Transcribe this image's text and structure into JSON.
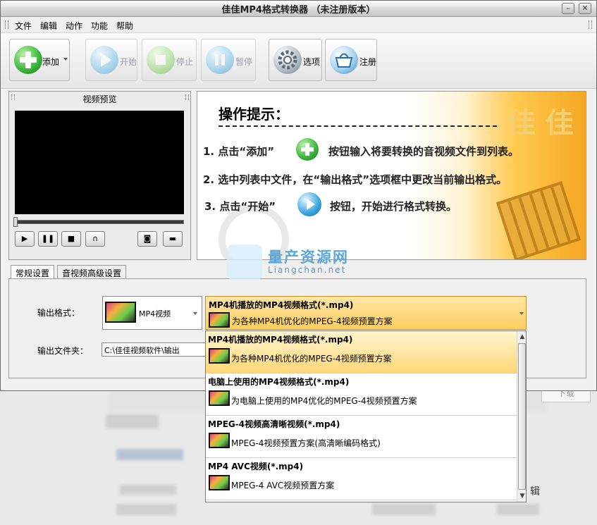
{
  "window": {
    "title": "佳佳MP4格式转换器  （未注册版本）"
  },
  "menu": [
    "文件",
    "编辑",
    "动作",
    "功能",
    "帮助"
  ],
  "toolbar": {
    "add": "添加",
    "start": "开始",
    "stop": "停止",
    "pause": "暂停",
    "options": "选项",
    "register": "注册"
  },
  "preview": {
    "title": "视频预览"
  },
  "tips": {
    "heading": "操作提示：",
    "logo": "佳 佳",
    "line1_a": "1. 点击“添加”",
    "line1_b": "按钮输入将要转换的音视频文件到列表。",
    "line2": "2. 选中列表中文件，在“输出格式”选项框中更改当前输出格式。",
    "line3_a": "3. 点击“开始”",
    "line3_b": "按钮，开始进行格式转换。"
  },
  "watermark": {
    "main": "量产资源网",
    "sub": "Liangchan.net"
  },
  "tabs": [
    "常规设置",
    "音视频高级设置"
  ],
  "settings": {
    "format_label": "输出格式：",
    "format_value": "MP4视频",
    "folder_label": "输出文件夹：",
    "folder_value": "C:\\佳佳视频软件\\输出",
    "preset_title": "MP4机播放的MP4视频格式(*.mp4)",
    "preset_desc": "为各种MP4机优化的MPEG-4视频预置方案"
  },
  "presets": [
    {
      "title": "MP4机播放的MP4视频格式(*.mp4)",
      "desc": "为各种MP4机优化的MPEG-4视频预置方案"
    },
    {
      "title": "电脑上使用的MP4视频格式(*.mp4)",
      "desc": "为电脑上使用的MP4优化的MPEG-4视频预置方案"
    },
    {
      "title": "MPEG-4视频高清晰视频(*.mp4)",
      "desc": "MPEG-4视频预置方案(高清晰编码格式)"
    },
    {
      "title": "MP4 AVC视频(*.mp4)",
      "desc": "MPEG-4 AVC视频预置方案"
    }
  ],
  "background": {
    "download_btn": "下载",
    "edit_text": "辑"
  }
}
